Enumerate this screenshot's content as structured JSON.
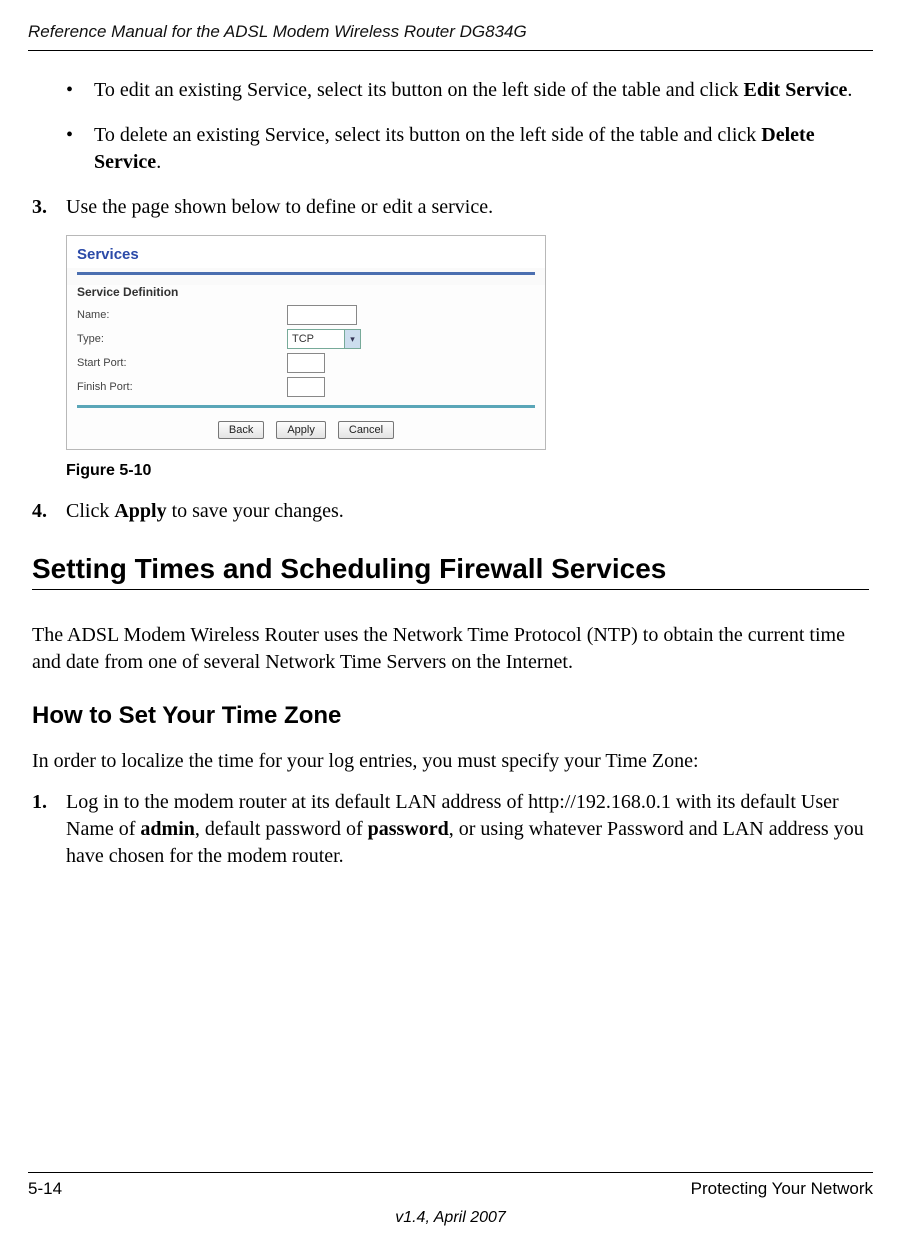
{
  "header": {
    "title": "Reference Manual for the ADSL Modem Wireless Router DG834G"
  },
  "bullets": {
    "b1_pre": "To edit an existing Service, select its button on the left side of the table and click ",
    "b1_bold": "Edit Service",
    "b1_post": ".",
    "b2_pre": "To delete an existing Service, select its button on the left side of the table and click ",
    "b2_bold": "Delete Service",
    "b2_post": "."
  },
  "steps": {
    "s3_num": "3.",
    "s3_text": "Use the page shown below to define or edit a service.",
    "s4_num": "4.",
    "s4_pre": "Click ",
    "s4_bold": "Apply",
    "s4_post": " to save your changes."
  },
  "figure": {
    "title": "Services",
    "subtitle": "Service Definition",
    "rows": {
      "name_label": "Name:",
      "type_label": "Type:",
      "type_value": "TCP",
      "start_label": "Start Port:",
      "finish_label": "Finish Port:"
    },
    "buttons": {
      "back": "Back",
      "apply": "Apply",
      "cancel": "Cancel"
    },
    "caption": "Figure 5-10"
  },
  "sections": {
    "h1": "Setting Times and Scheduling Firewall Services",
    "p1": "The ADSL Modem Wireless Router uses the Network Time Protocol (NTP) to obtain the current time and date from one of several Network Time Servers on the Internet.",
    "h2": "How to Set Your Time Zone",
    "p2": "In order to localize the time for your log entries, you must specify your Time Zone:",
    "step1_num": "1.",
    "step1_a": "Log in to the modem router at its default LAN address of http://192.168.0.1 with its default User Name of ",
    "step1_b": "admin",
    "step1_c": ", default password of ",
    "step1_d": "password",
    "step1_e": ", or using whatever Password and LAN address you have chosen for the modem router."
  },
  "footer": {
    "left": "5-14",
    "right": "Protecting Your Network",
    "center": "v1.4, April 2007"
  }
}
